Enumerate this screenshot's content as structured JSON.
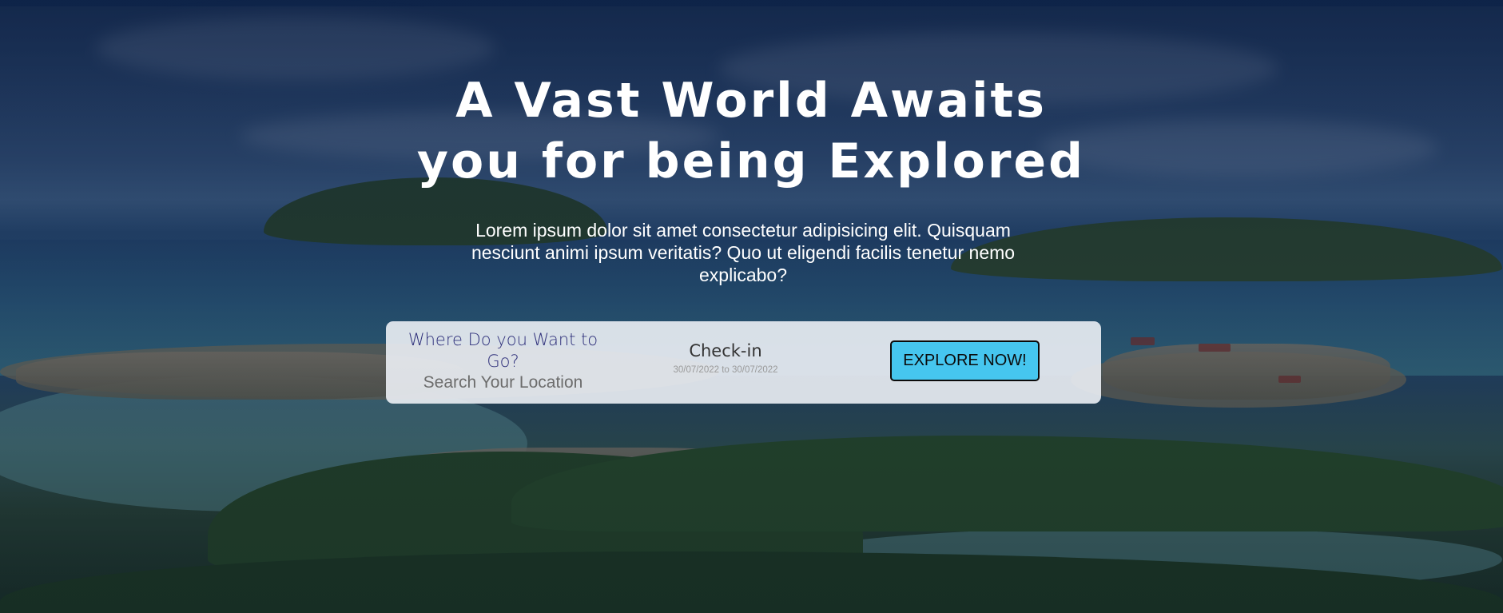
{
  "hero": {
    "title_line1": "A Vast World Awaits",
    "title_line2": "you for being Explored",
    "description": "Lorem ipsum dolor sit amet consectetur adipisicing elit. Quisquam nesciunt animi ipsum veritatis? Quo ut eligendi facilis tenetur nemo explicabo?",
    "background_image": "island-landscape"
  },
  "search": {
    "where_label": "Where Do you Want to Go?",
    "where_placeholder": "Search Your Location",
    "where_value": "",
    "checkin_label": "Check-in",
    "checkin_dates": "30/07/2022 to 30/07/2022",
    "button_label": "EXPLORE NOW!"
  },
  "colors": {
    "button_bg": "#46c6ef",
    "search_bg": "#eceff5",
    "where_label": "#2e2f7a",
    "topbar": "#12305e"
  }
}
